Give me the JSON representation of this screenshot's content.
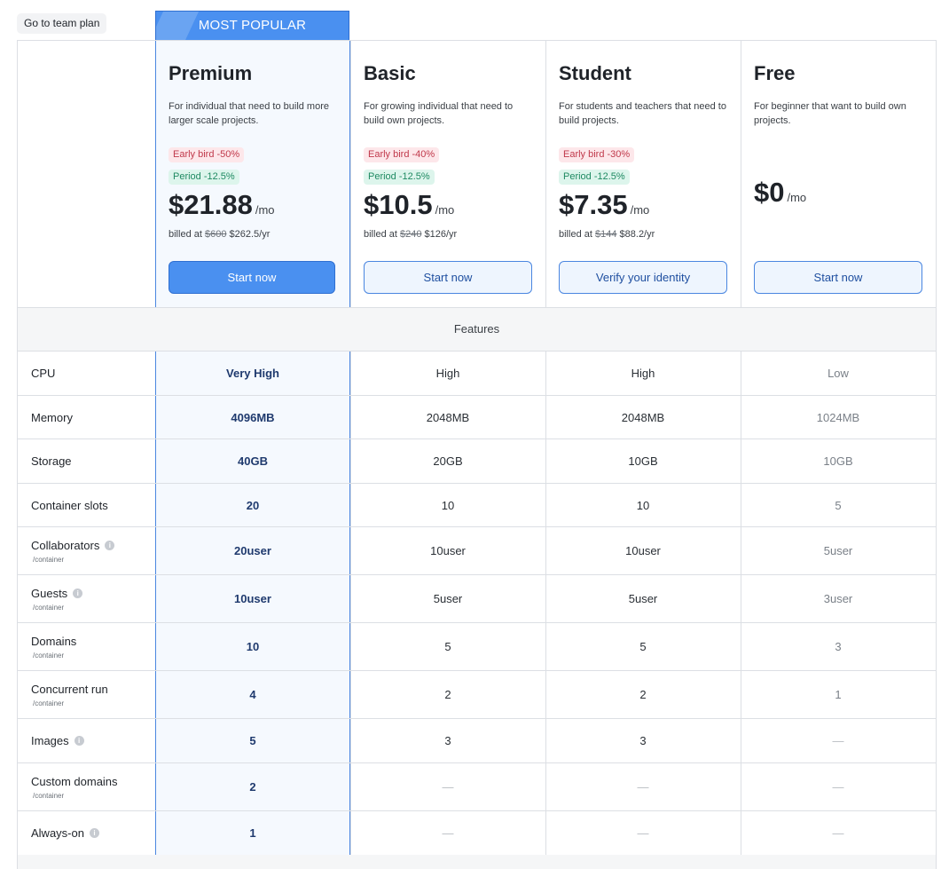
{
  "team_button": "Go to team plan",
  "most_popular": "MOST POPULAR",
  "features_label": "Features",
  "plans": [
    {
      "name": "Premium",
      "desc": "For individual that need to build more larger scale projects.",
      "chip1": "Early bird -50%",
      "chip2": "Period -12.5%",
      "price": "$21.88",
      "per": "/mo",
      "billed_prefix": "billed at",
      "billed_old": "$600",
      "billed_new": "$262.5/yr",
      "cta": "Start now"
    },
    {
      "name": "Basic",
      "desc": "For growing individual that need to build own projects.",
      "chip1": "Early bird -40%",
      "chip2": "Period -12.5%",
      "price": "$10.5",
      "per": "/mo",
      "billed_prefix": "billed at",
      "billed_old": "$240",
      "billed_new": "$126/yr",
      "cta": "Start now"
    },
    {
      "name": "Student",
      "desc": "For students and teachers that need to build projects.",
      "chip1": "Early bird -30%",
      "chip2": "Period -12.5%",
      "price": "$7.35",
      "per": "/mo",
      "billed_prefix": "billed at",
      "billed_old": "$144",
      "billed_new": "$88.2/yr",
      "cta": "Verify your identity"
    },
    {
      "name": "Free",
      "desc": "For beginner that want to build own projects.",
      "price": "$0",
      "per": "/mo",
      "cta": "Start now"
    }
  ],
  "rows": [
    {
      "label": "CPU",
      "values": [
        "Very High",
        "High",
        "High",
        "Low"
      ]
    },
    {
      "label": "Memory",
      "values": [
        "4096MB",
        "2048MB",
        "2048MB",
        "1024MB"
      ]
    },
    {
      "label": "Storage",
      "values": [
        "40GB",
        "20GB",
        "10GB",
        "10GB"
      ]
    },
    {
      "label": "Container slots",
      "values": [
        "20",
        "10",
        "10",
        "5"
      ]
    },
    {
      "label": "Collaborators",
      "sub": "/container",
      "values": [
        "20user",
        "10user",
        "10user",
        "5user"
      ]
    },
    {
      "label": "Guests",
      "sub": "/container",
      "values": [
        "10user",
        "5user",
        "5user",
        "3user"
      ]
    },
    {
      "label": "Domains",
      "sub": "/container",
      "values": [
        "10",
        "5",
        "5",
        "3"
      ]
    },
    {
      "label": "Concurrent run",
      "sub": "/container",
      "values": [
        "4",
        "2",
        "2",
        "1"
      ]
    },
    {
      "label": "Images",
      "values": [
        "5",
        "3",
        "3",
        "—"
      ]
    },
    {
      "label": "Custom domains",
      "sub": "/container",
      "values": [
        "2",
        "—",
        "—",
        "—"
      ]
    },
    {
      "label": "Always-on",
      "values": [
        "1",
        "—",
        "—",
        "—"
      ]
    }
  ],
  "info_icon": "i"
}
